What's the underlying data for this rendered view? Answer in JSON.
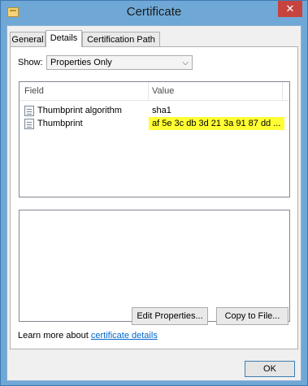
{
  "window": {
    "title": "Certificate",
    "close_glyph": "✕"
  },
  "tabs": [
    {
      "label": "General"
    },
    {
      "label": "Details"
    },
    {
      "label": "Certification Path"
    }
  ],
  "show": {
    "label": "Show:",
    "selected": "Properties Only"
  },
  "list": {
    "col_field": "Field",
    "col_value": "Value",
    "rows": [
      {
        "field": "Thumbprint algorithm",
        "value": "sha1"
      },
      {
        "field": "Thumbprint",
        "value": "af 5e 3c db 3d 21 3a 91 87 dd ..."
      }
    ],
    "highlight_color": "#ffff33"
  },
  "buttons": {
    "edit_properties": "Edit Properties...",
    "copy_to_file": "Copy to File...",
    "ok": "OK"
  },
  "learn_more": {
    "prefix": "Learn more about ",
    "link": "certificate details"
  }
}
